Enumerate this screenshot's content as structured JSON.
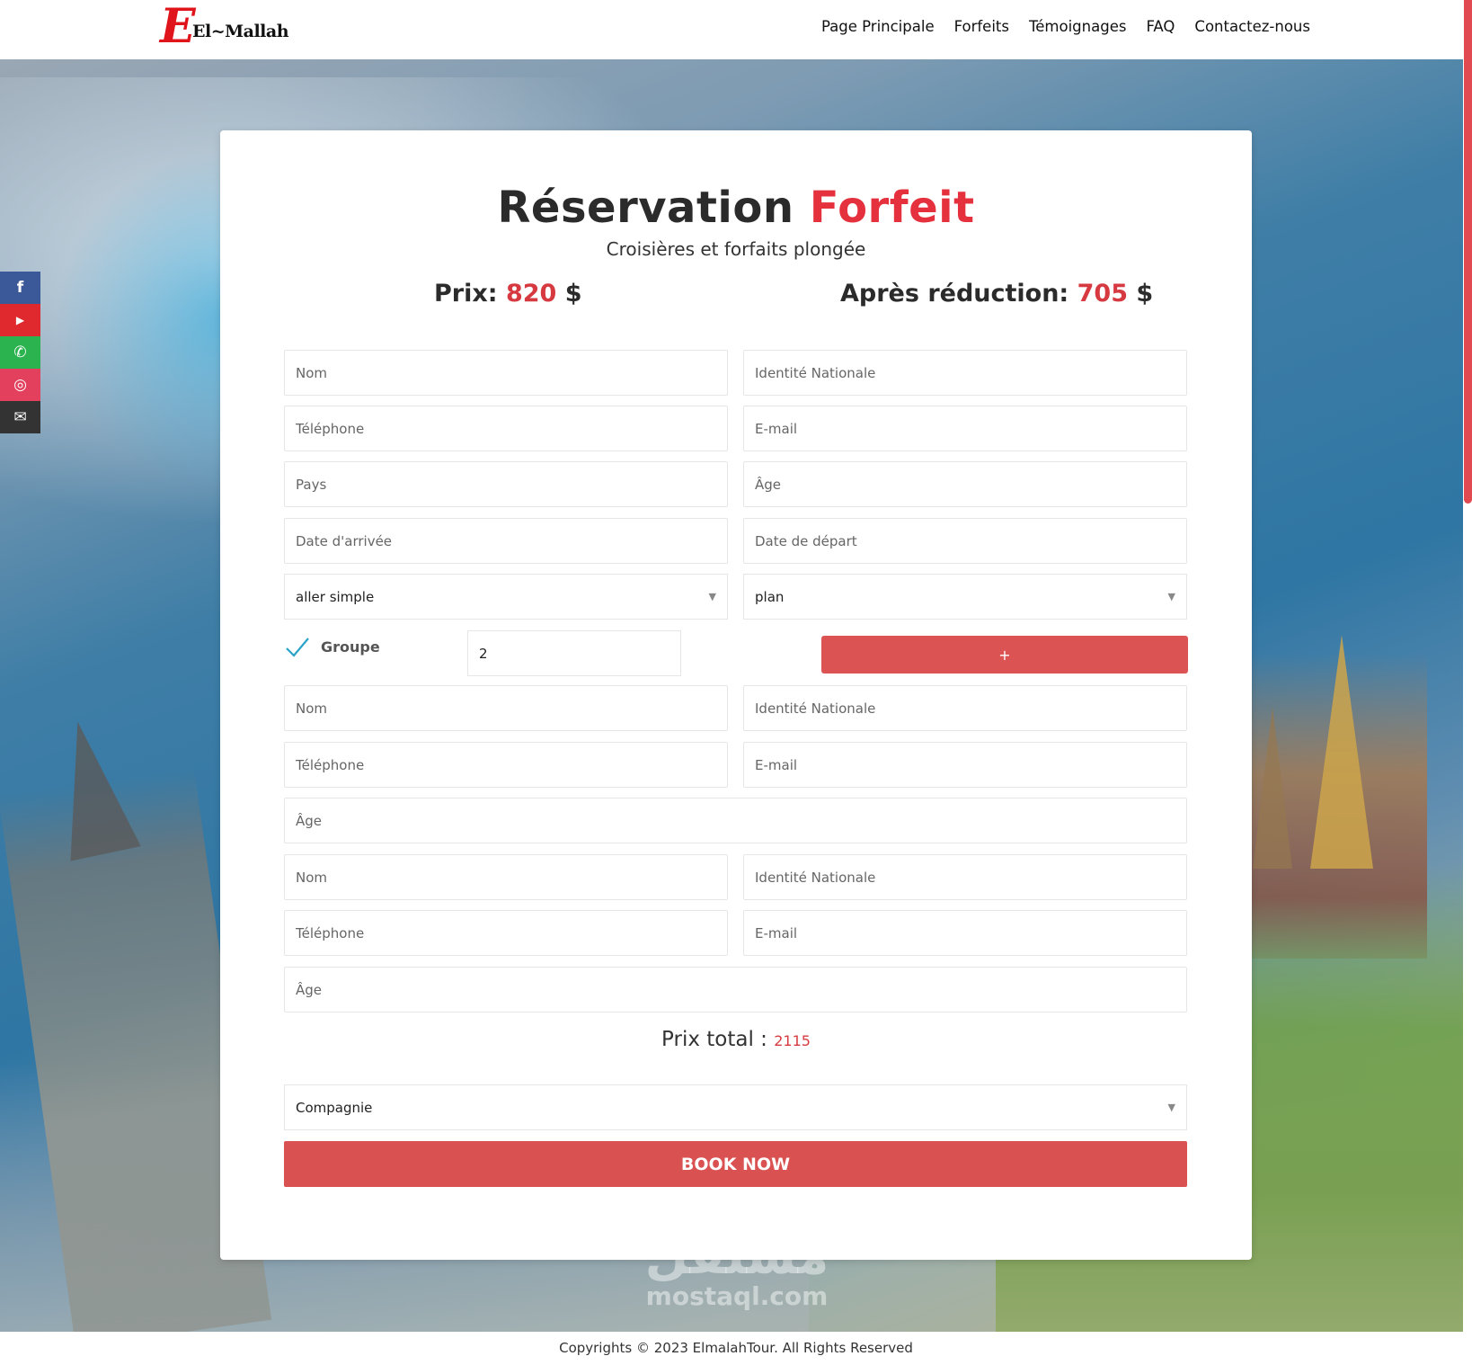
{
  "header": {
    "logo_letter": "E",
    "logo_text": "El~Mallah",
    "nav": [
      "Page Principale",
      "Forfeits",
      "Témoignages",
      "FAQ",
      "Contactez-nous"
    ]
  },
  "social": [
    {
      "icon": "facebook-icon",
      "glyph": "f",
      "color": "#3b5998"
    },
    {
      "icon": "youtube-icon",
      "glyph": "▶",
      "color": "#e0292e"
    },
    {
      "icon": "whatsapp-icon",
      "glyph": "✆",
      "color": "#2bb34f"
    },
    {
      "icon": "instagram-icon",
      "glyph": "◎",
      "color": "#e2405c"
    },
    {
      "icon": "mail-icon",
      "glyph": "✉",
      "color": "#333333"
    }
  ],
  "card": {
    "title_main": "Réservation",
    "title_accent": "Forfeit",
    "subtitle": "Croisières et forfaits plongée",
    "price": {
      "label": "Prix:",
      "value": "820",
      "currency": "$"
    },
    "discount": {
      "label": "Après réduction:",
      "value": "705",
      "currency": "$"
    }
  },
  "form": {
    "nom": "Nom",
    "identite": "Identité Nationale",
    "telephone": "Téléphone",
    "email": "E-mail",
    "pays": "Pays",
    "age": "Âge",
    "date_arrivee": "Date d'arrivée",
    "date_depart": "Date de départ",
    "trip_type": "aller simple",
    "plan": "plan",
    "group_label": "Groupe",
    "group_count": "2",
    "add_label": "+",
    "total_label": "Prix total :",
    "total_value": "2115",
    "company": "Compagnie",
    "book_label": "BOOK NOW"
  },
  "watermark": {
    "arabic": "مستقل",
    "latin": "mostaql.com"
  },
  "footer": {
    "text": "Copyrights © 2023 ElmalahTour. All Rights Reserved"
  },
  "colors": {
    "accent": "#e5303d",
    "button": "#dc5353",
    "check": "#2aa3c9"
  }
}
